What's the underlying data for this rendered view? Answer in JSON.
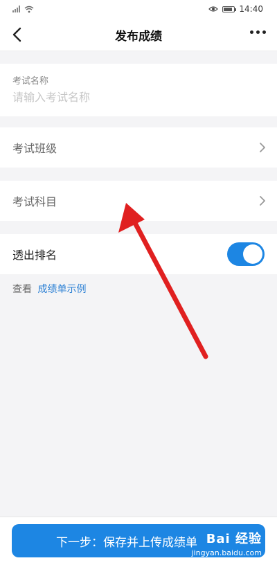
{
  "status_bar": {
    "time": "14:40"
  },
  "nav": {
    "title": "发布成绩"
  },
  "form": {
    "exam_name_label": "考试名称",
    "exam_name_placeholder": "请输入考试名称",
    "exam_class_label": "考试班级",
    "exam_subject_label": "考试科目",
    "rank_label": "透出排名",
    "rank_enabled": true,
    "view_prefix": "查看",
    "view_link": "成绩单示例"
  },
  "footer": {
    "next_button_label": "下一步：保存并上传成绩单"
  },
  "watermark": {
    "logo": "Bai 经验",
    "url": "jingyan.baidu.com"
  },
  "colors": {
    "accent": "#1d86e3",
    "link": "#2a7fd4",
    "annotation_arrow": "#e02020"
  },
  "icons": [
    "signal-icon",
    "wifi-icon",
    "eye-icon",
    "battery-icon",
    "back-arrow-icon",
    "more-icon",
    "chevron-right-icon"
  ]
}
